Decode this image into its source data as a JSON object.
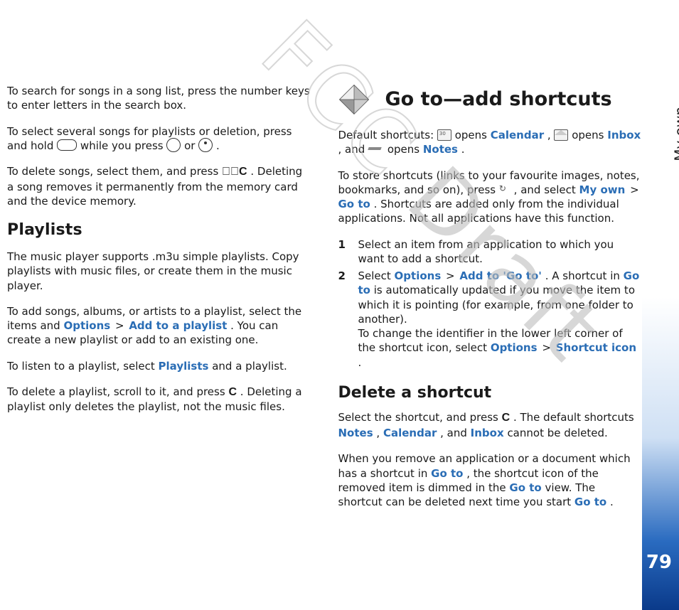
{
  "rail": {
    "label": "My own",
    "page_number": "79"
  },
  "watermark": {
    "fcc": "FCC ",
    "draft": "Draft"
  },
  "left": {
    "p1": "To search for songs in a song list, press the number keys to enter letters in the search box.",
    "p2a": "To select several songs for playlists or deletion, press and hold ",
    "p2b": " while you press ",
    "p2c": " or ",
    "p2d": ".",
    "p3a": "To delete songs, select them, and press ",
    "p3b": ". Deleting a song removes it permanently from the memory card and the device memory.",
    "h_playlists": "Playlists",
    "p4": "The music player supports .m3u simple playlists. Copy playlists with music files, or create them in the music player.",
    "p5a": "To add songs, albums, or artists to a playlist, select the items and ",
    "p5_options": "Options",
    "p5_gt": " > ",
    "p5_add": "Add to a playlist",
    "p5b": ". You can create a new playlist or add to an existing one.",
    "p6a": "To listen to a playlist, select ",
    "p6_playlists": "Playlists",
    "p6b": " and a playlist.",
    "p7a": "To delete a playlist, scroll to it, and press ",
    "p7b": ". Deleting a playlist only deletes the playlist, not the music files."
  },
  "right": {
    "h_goto": "Go to—add shortcuts",
    "ds_a": "Default shortcuts: ",
    "ds_b": " opens ",
    "ds_cal": "Calendar",
    "ds_c": ", ",
    "ds_d": " opens ",
    "ds_inbox": "Inbox",
    "ds_e": ", and ",
    "ds_f": " opens ",
    "ds_notes": "Notes",
    "ds_g": ".",
    "store_a": "To store shortcuts (links to your favourite images, notes, bookmarks, and so on), press ",
    "store_b": ", and select ",
    "store_myown": "My own",
    "store_gt": " > ",
    "store_goto": "Go to",
    "store_c": ". Shortcuts are added only from the individual applications. Not all applications have this function.",
    "step1": "Select an item from an application to which you want to add a shortcut.",
    "step2a": "Select ",
    "step2_options": "Options",
    "step2_gt": " > ",
    "step2_add": "Add to 'Go to'",
    "step2b": ". A shortcut in ",
    "step2_goto1": "Go to",
    "step2c": " is automatically updated if you move the item to which it is pointing (for example, from one folder to another).",
    "step2d_a": "To change the identifier in the lower left corner of the shortcut icon, select ",
    "step2d_options": "Options",
    "step2d_gt": " > ",
    "step2d_si": "Shortcut icon",
    "step2d_b": ".",
    "h_delete": "Delete a shortcut",
    "del1a": "Select the shortcut, and press ",
    "del1b": ". The default shortcuts ",
    "del1_notes": "Notes",
    "del1_c": ", ",
    "del1_cal": "Calendar",
    "del1_d": ", and ",
    "del1_inbox": "Inbox",
    "del1_e": " cannot be deleted.",
    "del2a": "When you remove an application or a document which has a shortcut in ",
    "del2_goto1": "Go to",
    "del2b": ", the shortcut icon of the removed item is dimmed in the ",
    "del2_goto2": "Go to",
    "del2c": " view. The shortcut can be deleted next time you start ",
    "del2_goto3": "Go to",
    "del2d": "."
  },
  "nums": {
    "one": "1",
    "two": "2"
  }
}
